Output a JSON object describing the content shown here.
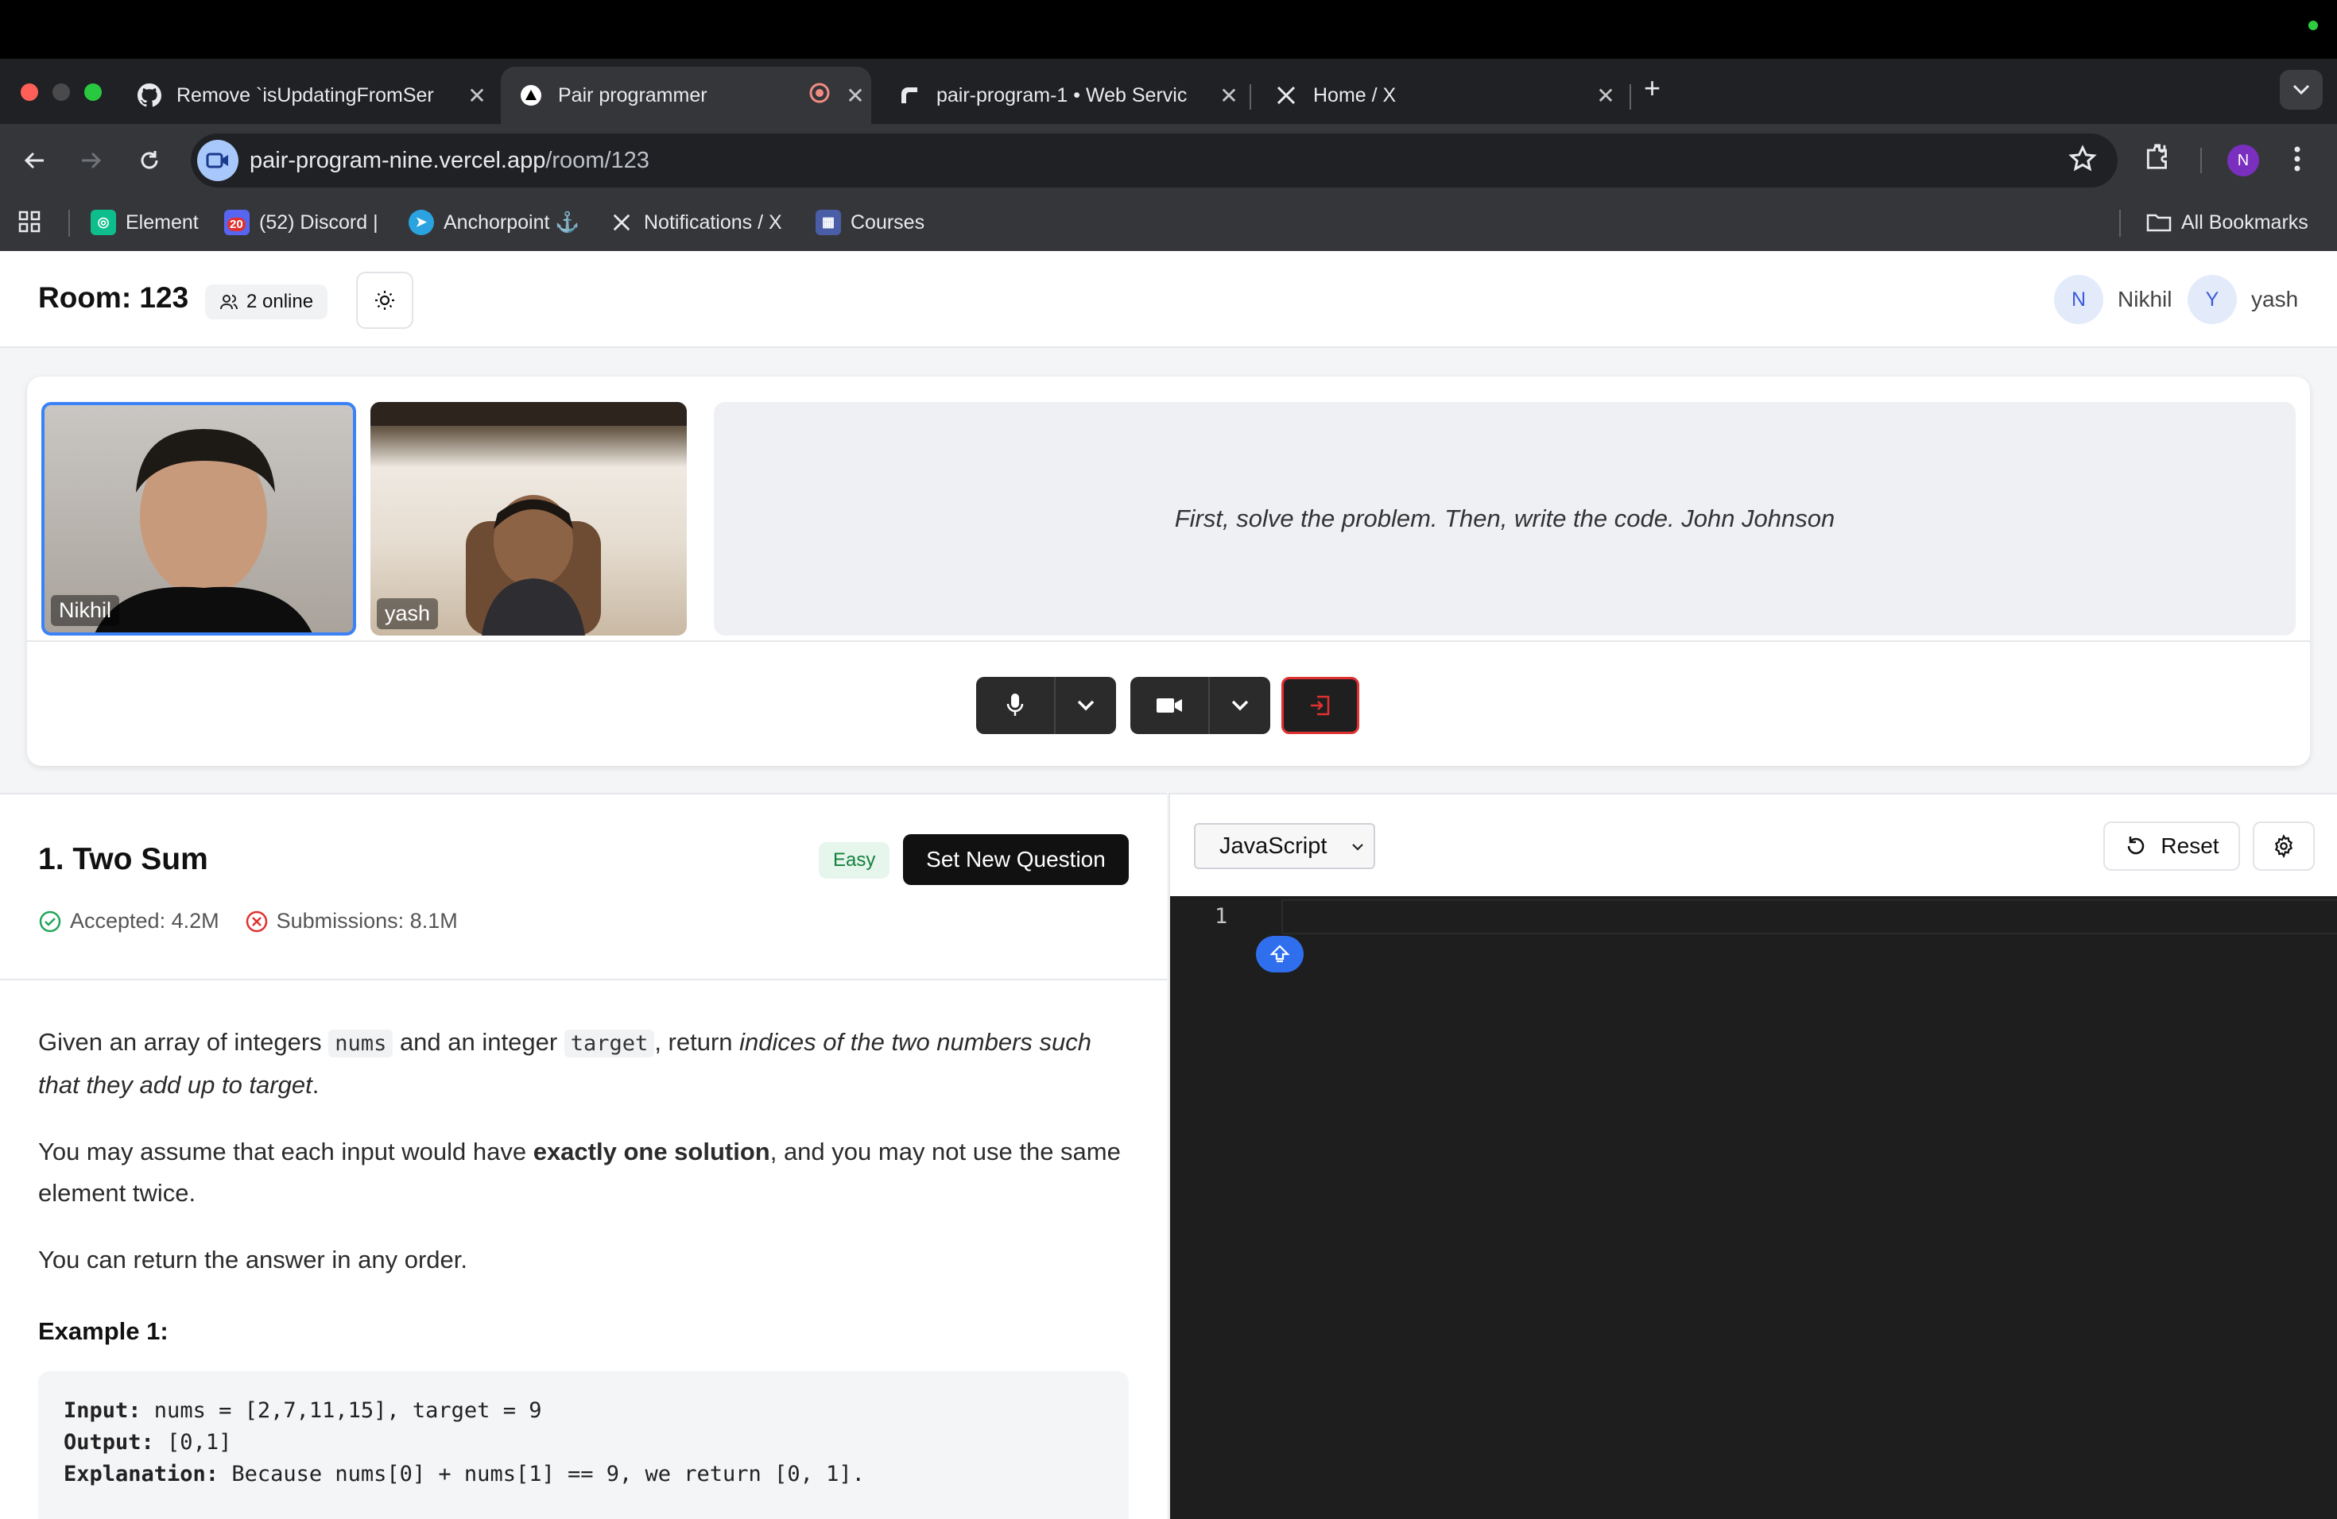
{
  "browser": {
    "tabs": [
      {
        "label": "Remove `isUpdatingFromSer",
        "icon": "github-icon",
        "active": false
      },
      {
        "label": "Pair programmer",
        "icon": "triangle-logo-icon",
        "active": true
      },
      {
        "label": "pair-program-1 • Web Servic",
        "icon": "render-icon",
        "active": false
      },
      {
        "label": "Home / X",
        "icon": "x-logo-icon",
        "active": false
      }
    ],
    "url_host": "pair-program-nine.vercel.app",
    "url_path": "/room/123",
    "profile_initial": "N",
    "bookmarks": [
      {
        "label": "Element",
        "icon": "element-icon"
      },
      {
        "label": "(52) Discord |",
        "icon": "discord-icon",
        "badge": "20"
      },
      {
        "label": "Anchorpoint ⚓",
        "icon": "telegram-icon"
      },
      {
        "label": "Notifications / X",
        "icon": "x-logo-icon"
      },
      {
        "label": "Courses",
        "icon": "courses-icon"
      }
    ],
    "all_bookmarks": "All Bookmarks"
  },
  "header": {
    "room_title": "Room: 123",
    "online": "2 online",
    "users": [
      {
        "initial": "N",
        "name": "Nikhil"
      },
      {
        "initial": "Y",
        "name": "yash"
      }
    ]
  },
  "video": {
    "participants": [
      "Nikhil",
      "yash"
    ],
    "quote": "First, solve the problem. Then, write the code. John Johnson"
  },
  "problem": {
    "title": "1. Two Sum",
    "difficulty": "Easy",
    "new_question_label": "Set New Question",
    "accepted": "Accepted: 4.2M",
    "submissions": "Submissions: 8.1M",
    "p1_a": "Given an array of integers ",
    "p1_code1": "nums",
    "p1_b": " and an integer ",
    "p1_code2": "target",
    "p1_c": ", return ",
    "p1_em": "indices of the two numbers such that they add up to target",
    "p1_d": ".",
    "p2_a": "You may assume that each input would have ",
    "p2_b": "exactly one solution",
    "p2_c": ", and you may not use the same element twice.",
    "p3": "You can return the answer in any order.",
    "example_title": "Example 1:",
    "example": {
      "input_label": "Input:",
      "input": " nums = [2,7,11,15], target = 9",
      "output_label": "Output:",
      "output": " [0,1]",
      "explanation_label": "Explanation:",
      "explanation": " Because nums[0] + nums[1] == 9, we return [0, 1]."
    }
  },
  "editor": {
    "language": "JavaScript",
    "reset_label": "Reset",
    "line_number": "1"
  },
  "colors": {
    "accent_blue": "#3b82f6",
    "leave_red": "#e03131",
    "easy_green": "#15803d"
  }
}
